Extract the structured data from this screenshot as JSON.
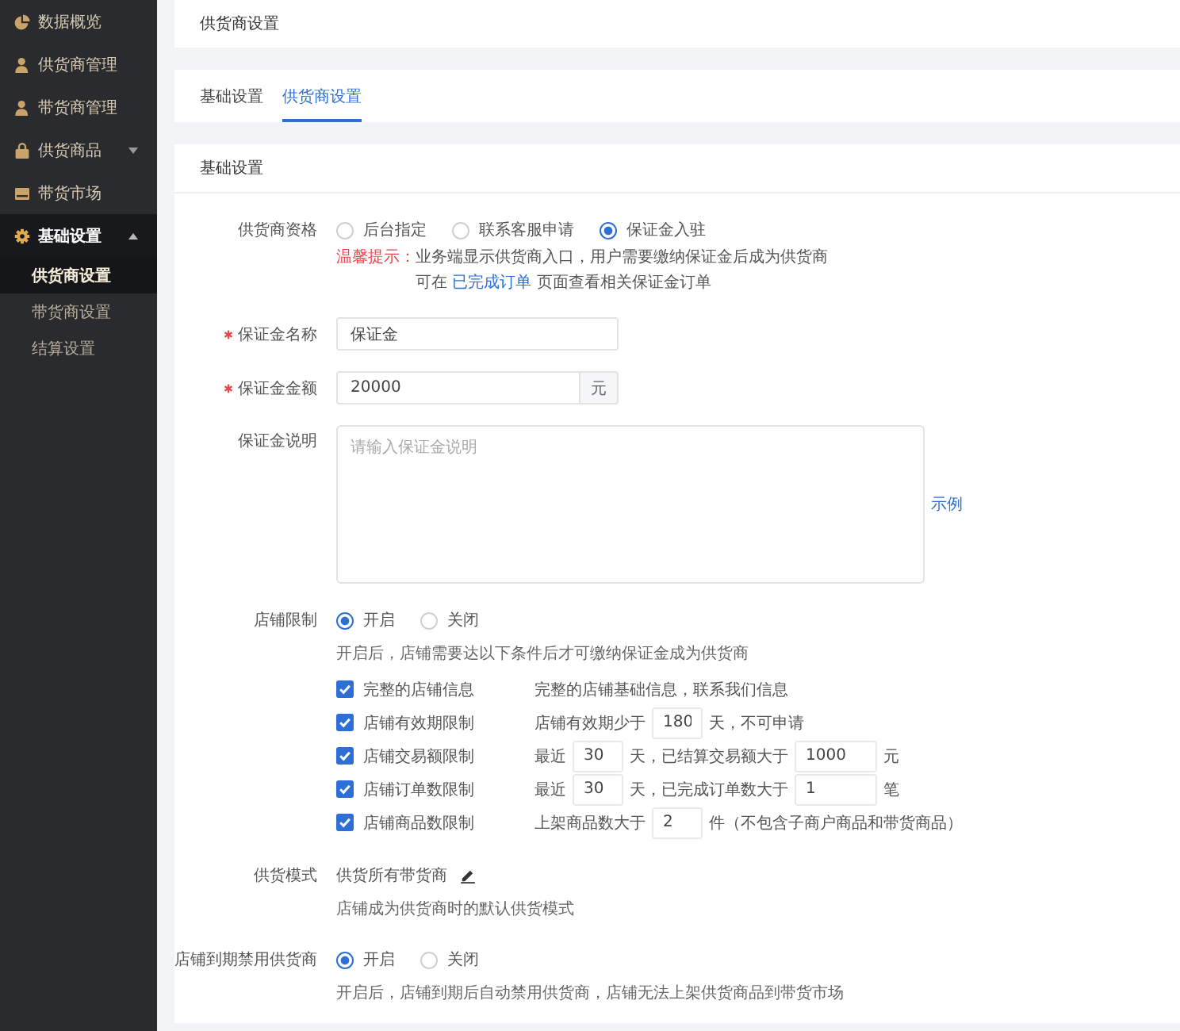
{
  "sidebar": {
    "items": [
      {
        "label": "数据概览",
        "kind": "link",
        "selected": false
      },
      {
        "label": "供货商管理",
        "kind": "link",
        "selected": false
      },
      {
        "label": "带货商管理",
        "kind": "link",
        "selected": false
      },
      {
        "label": "供货商品",
        "kind": "group",
        "expanded": false,
        "selected": false
      },
      {
        "label": "带货市场",
        "kind": "link",
        "selected": false
      },
      {
        "label": "基础设置",
        "kind": "group",
        "expanded": true,
        "selected": true,
        "children": [
          {
            "label": "供货商设置",
            "selected": true
          },
          {
            "label": "带货商设置",
            "selected": false
          },
          {
            "label": "结算设置",
            "selected": false
          }
        ]
      }
    ]
  },
  "page_header": {
    "title": "供货商设置"
  },
  "tabs": [
    {
      "label": "基础设置",
      "selected": false
    },
    {
      "label": "供货商设置",
      "selected": true
    }
  ],
  "section": {
    "title": "基础设置",
    "fields": [
      {
        "kind": "radio",
        "label": "供货商资格",
        "required": false,
        "options": [
          {
            "label": "后台指定",
            "selected": false
          },
          {
            "label": "联系客服申请",
            "selected": false
          },
          {
            "label": "保证金入驻",
            "selected": true
          }
        ],
        "tip": {
          "label": "温馨提示：",
          "text": "业务端显示供货商入口，用户需要缴纳保证金后成为供货商",
          "before": "可在",
          "link": "已完成订单",
          "after": "页面查看相关保证金订单"
        }
      },
      {
        "kind": "text",
        "label": "保证金名称",
        "required": true,
        "value": "保证金"
      },
      {
        "kind": "amount",
        "label": "保证金金额",
        "required": true,
        "value": "20000",
        "unit": "元"
      },
      {
        "kind": "textarea",
        "label": "保证金说明",
        "required": false,
        "placeholder": "请输入保证金说明",
        "link": "示例"
      },
      {
        "kind": "radio",
        "label": "店铺限制",
        "required": false,
        "options": [
          {
            "label": "开启",
            "selected": true
          },
          {
            "label": "关闭",
            "selected": false
          }
        ],
        "hint": "开启后，店铺需要达以下条件后才可缴纳保证金成为供货商",
        "conditions": [
          {
            "label": "完整的店铺信息",
            "checked": true,
            "parts": [
              {
                "kind": "text",
                "text": "完整的店铺基础信息，联系我们信息"
              }
            ]
          },
          {
            "label": "店铺有效期限制",
            "checked": true,
            "parts": [
              {
                "kind": "text",
                "text": "店铺有效期少于"
              },
              {
                "kind": "input",
                "value": "180"
              },
              {
                "kind": "text",
                "text": "天，不可申请"
              }
            ]
          },
          {
            "label": "店铺交易额限制",
            "checked": true,
            "parts": [
              {
                "kind": "text",
                "text": "最近"
              },
              {
                "kind": "input",
                "value": "30"
              },
              {
                "kind": "text",
                "text": "天，已结算交易额大于"
              },
              {
                "kind": "input",
                "value": "1000"
              },
              {
                "kind": "text",
                "text": "元"
              }
            ]
          },
          {
            "label": "店铺订单数限制",
            "checked": true,
            "parts": [
              {
                "kind": "text",
                "text": "最近"
              },
              {
                "kind": "input",
                "value": "30"
              },
              {
                "kind": "text",
                "text": "天，已完成订单数大于"
              },
              {
                "kind": "input",
                "value": "1"
              },
              {
                "kind": "text",
                "text": "笔"
              }
            ]
          },
          {
            "label": "店铺商品数限制",
            "checked": true,
            "parts": [
              {
                "kind": "text",
                "text": "上架商品数大于"
              },
              {
                "kind": "input",
                "value": "2"
              },
              {
                "kind": "text",
                "text": "件（不包含子商户商品和带货商品）"
              }
            ]
          }
        ]
      },
      {
        "kind": "mode",
        "label": "供货模式",
        "required": false,
        "value": "供货所有带货商",
        "hint": "店铺成为供货商时的默认供货模式"
      },
      {
        "kind": "radio",
        "label": "店铺到期禁用供货商",
        "required": false,
        "options": [
          {
            "label": "开启",
            "selected": true
          },
          {
            "label": "关闭",
            "selected": false
          }
        ],
        "hint": "开启后，店铺到期后自动禁用供货商，店铺无法上架供货商品到带货市场"
      }
    ]
  }
}
